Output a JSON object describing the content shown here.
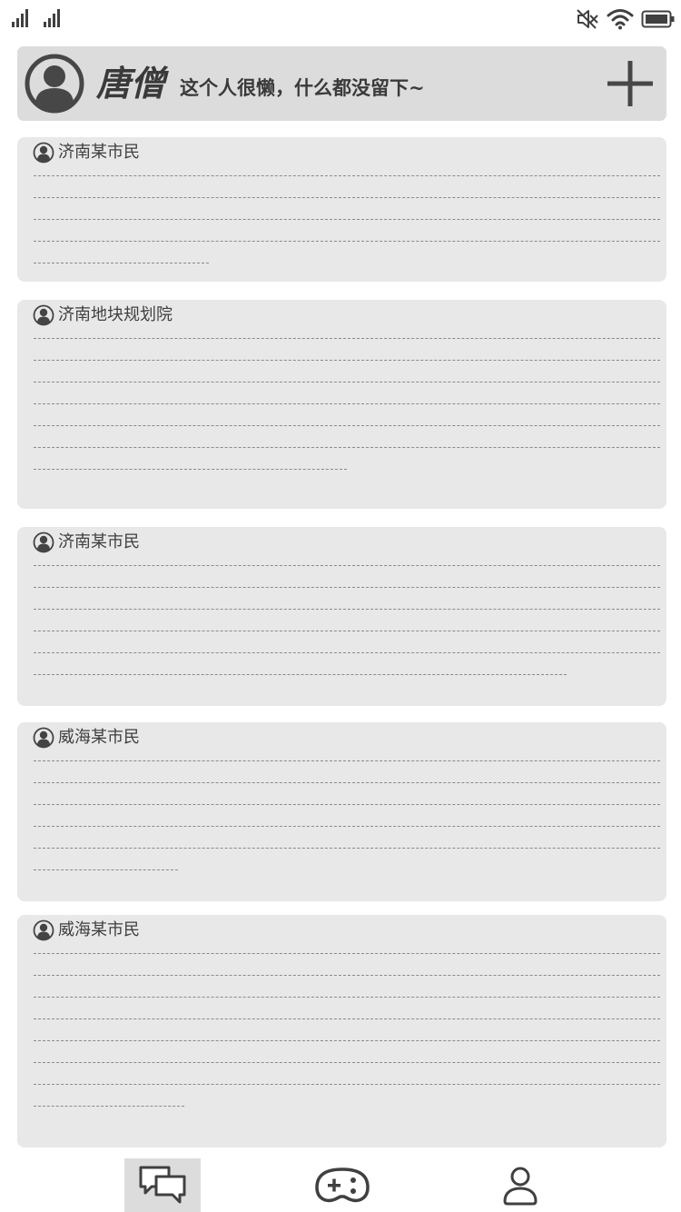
{
  "status_bar": {
    "icons": [
      "signal-icon",
      "signal-icon",
      "mute-icon",
      "wifi-icon",
      "battery-icon"
    ]
  },
  "profile": {
    "name": "唐僧",
    "bio": "这个人很懒，什么都没留下~",
    "avatar_icon": "user-avatar-icon",
    "add_icon": "plus-icon"
  },
  "feed": {
    "posts": [
      {
        "author": "济南某市民",
        "full_lines": 4,
        "last_line_fraction": 0.28
      },
      {
        "author": "济南地块规划院",
        "full_lines": 6,
        "last_line_fraction": 0.5
      },
      {
        "author": "济南某市民",
        "full_lines": 5,
        "last_line_fraction": 0.85
      },
      {
        "author": "威海某市民",
        "full_lines": 5,
        "last_line_fraction": 0.23
      },
      {
        "author": "威海某市民",
        "full_lines": 7,
        "last_line_fraction": 0.24
      }
    ]
  },
  "tab_bar": {
    "tabs": [
      {
        "icon": "chat-bubbles-icon",
        "active": true
      },
      {
        "icon": "gamepad-icon",
        "active": false
      },
      {
        "icon": "user-icon",
        "active": false
      }
    ]
  },
  "colors": {
    "header_bg": "#dcdcdc",
    "card_bg": "#e8e8e8",
    "icon": "#404040",
    "text": "#3f3f3f"
  }
}
